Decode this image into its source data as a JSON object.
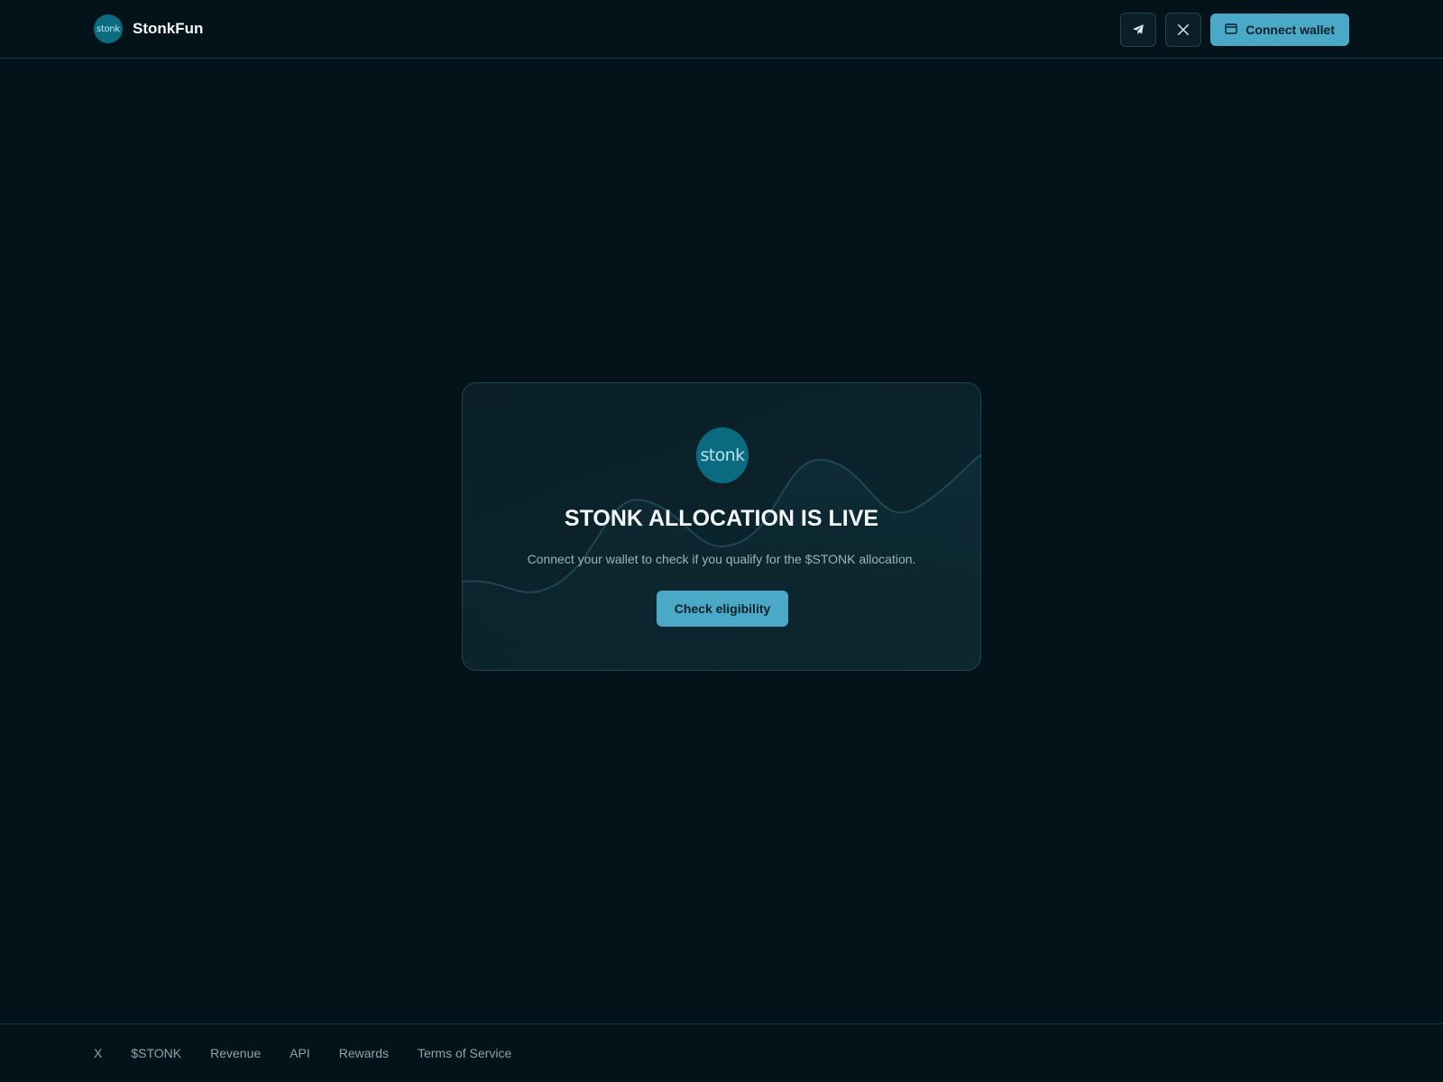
{
  "header": {
    "brand_logo_text": "stonk",
    "brand_name": "StonkFun",
    "telegram_icon": "telegram-icon",
    "x_icon": "x-icon",
    "wallet_icon": "wallet-icon",
    "connect_label": "Connect wallet"
  },
  "card": {
    "logo_text": "stonk",
    "title": "STONK ALLOCATION IS LIVE",
    "subtitle": "Connect your wallet to check if you qualify for the $STONK allocation.",
    "button_label": "Check eligibility"
  },
  "footer": {
    "links": [
      "X",
      "$STONK",
      "Revenue",
      "API",
      "Rewards",
      "Terms of Service"
    ]
  },
  "colors": {
    "background": "#04121a",
    "accent": "#4aa9c6",
    "logo": "#0a6a7f",
    "border": "#1c4752"
  }
}
